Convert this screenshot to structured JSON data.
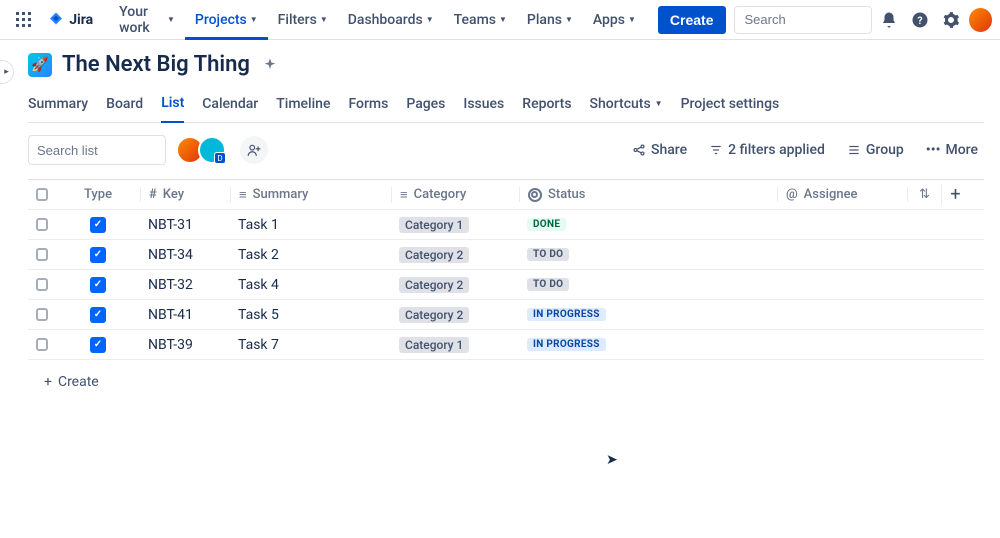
{
  "topnav": {
    "logo": "Jira",
    "items": [
      {
        "label": "Your work"
      },
      {
        "label": "Projects",
        "active": true
      },
      {
        "label": "Filters"
      },
      {
        "label": "Dashboards"
      },
      {
        "label": "Teams"
      },
      {
        "label": "Plans"
      },
      {
        "label": "Apps"
      }
    ],
    "create": "Create",
    "search_placeholder": "Search"
  },
  "project": {
    "title": "The Next Big Thing"
  },
  "tabs": [
    {
      "label": "Summary"
    },
    {
      "label": "Board"
    },
    {
      "label": "List",
      "active": true
    },
    {
      "label": "Calendar"
    },
    {
      "label": "Timeline"
    },
    {
      "label": "Forms"
    },
    {
      "label": "Pages"
    },
    {
      "label": "Issues"
    },
    {
      "label": "Reports"
    },
    {
      "label": "Shortcuts",
      "dropdown": true
    },
    {
      "label": "Project settings"
    }
  ],
  "toolbar": {
    "search_placeholder": "Search list",
    "share": "Share",
    "filters": "2 filters applied",
    "group": "Group",
    "more": "More"
  },
  "columns": {
    "type": "Type",
    "key": "Key",
    "summary": "Summary",
    "category": "Category",
    "status": "Status",
    "assignee": "Assignee"
  },
  "rows": [
    {
      "key": "NBT-31",
      "summary": "Task 1",
      "category": "Category 1",
      "status": "DONE",
      "status_class": "done"
    },
    {
      "key": "NBT-34",
      "summary": "Task 2",
      "category": "Category 2",
      "status": "TO DO",
      "status_class": "todo"
    },
    {
      "key": "NBT-32",
      "summary": "Task 4",
      "category": "Category 2",
      "status": "TO DO",
      "status_class": "todo"
    },
    {
      "key": "NBT-41",
      "summary": "Task 5",
      "category": "Category 2",
      "status": "IN PROGRESS",
      "status_class": "inprogress"
    },
    {
      "key": "NBT-39",
      "summary": "Task 7",
      "category": "Category 1",
      "status": "IN PROGRESS",
      "status_class": "inprogress"
    }
  ],
  "create_row": "Create"
}
